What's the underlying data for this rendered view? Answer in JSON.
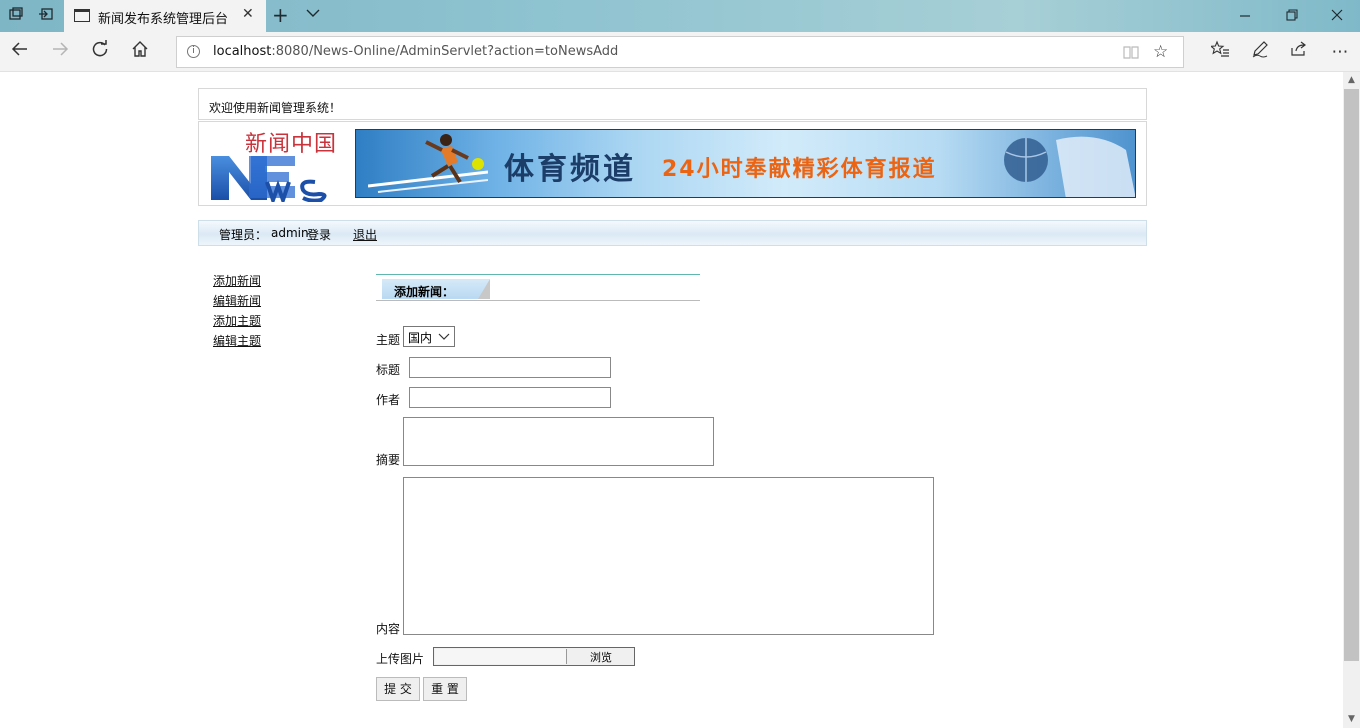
{
  "browser": {
    "tab_title": "新闻发布系统管理后台",
    "url_host": "localhost",
    "url_rest": ":8080/News-Online/AdminServlet?action=toNewsAdd",
    "icons": {
      "tab_manager": "tab-manager-icon",
      "set_aside": "set-aside-icon",
      "back": "back-icon",
      "forward": "forward-icon",
      "refresh": "refresh-icon",
      "home": "home-icon",
      "favorites": "star-icon"
    }
  },
  "page": {
    "welcome": "欢迎使用新闻管理系统！",
    "logo_cn": "新闻中国",
    "banner_title": "体育频道",
    "banner_slogan": "24小时奉献精彩体育报道",
    "admin_label": "管理员：",
    "admin_name": "admin",
    "login_text": "登录",
    "logout_text": "退出",
    "sidebar": [
      "添加新闻",
      "编辑新闻",
      "添加主题",
      "编辑主题"
    ],
    "section_title": "添加新闻：",
    "form": {
      "topic_label": "主题",
      "topic_value": "国内",
      "title_label": "标题",
      "author_label": "作者",
      "summary_label": "摘要",
      "content_label": "内容",
      "upload_label": "上传图片",
      "browse_label": "浏览",
      "submit_label": "提 交",
      "reset_label": "重 置"
    }
  }
}
